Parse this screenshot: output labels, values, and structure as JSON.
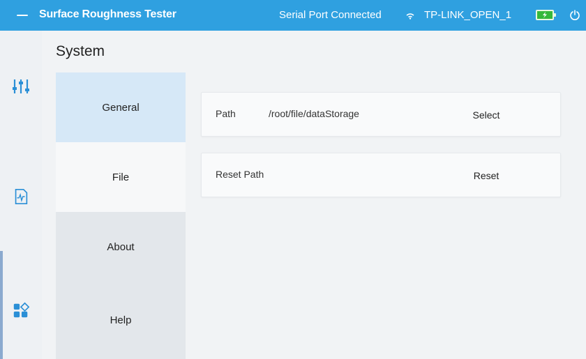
{
  "topbar": {
    "title": "Surface Roughness Tester",
    "serial_status": "Serial Port Connected",
    "wifi_name": "TP-LINK_OPEN_1",
    "icons": {
      "menu": "menu-icon",
      "wifi": "wifi-icon",
      "battery": "battery-charging-icon",
      "power": "power-icon"
    },
    "colors": {
      "bar": "#2fa0e0",
      "battery": "#36b83a"
    }
  },
  "rail": {
    "items": [
      {
        "icon": "sliders-icon"
      },
      {
        "icon": "waveform-document-icon"
      },
      {
        "icon": "app-grid-icon"
      }
    ]
  },
  "page": {
    "title": "System"
  },
  "categories": [
    {
      "label": "General"
    },
    {
      "label": "File"
    },
    {
      "label": "About"
    },
    {
      "label": "Help"
    }
  ],
  "settings": {
    "path": {
      "label": "Path",
      "value": "/root/file/dataStorage",
      "action": "Select"
    },
    "reset": {
      "label": "Reset Path",
      "action": "Reset"
    }
  }
}
